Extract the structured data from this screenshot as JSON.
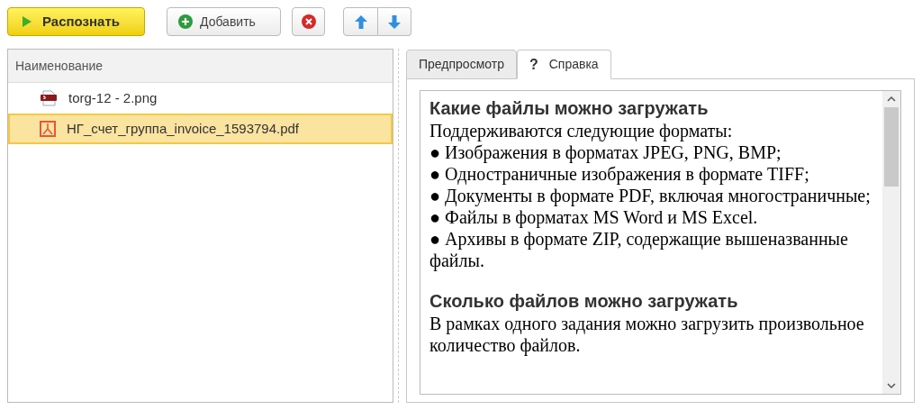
{
  "toolbar": {
    "recognize_button": "Распознать",
    "add_button": "Добавить"
  },
  "file_list": {
    "column": "Наименование",
    "rows": [
      {
        "name": "torg-12 - 2.png",
        "kind": "png",
        "selected": false
      },
      {
        "name": "НГ_счет_группа_invoice_1593794.pdf",
        "kind": "pdf",
        "selected": true
      }
    ]
  },
  "tabs": [
    {
      "label": "Предпросмотр",
      "selected": false
    },
    {
      "label": "Справка",
      "icon": "?",
      "selected": true
    }
  ],
  "help": [
    {
      "heading": "Какие файлы можно загружать",
      "intro": "Поддерживаются следующие форматы:",
      "bullets": [
        "● Изображения в форматах JPEG, PNG, BMP;",
        "● Одностраничные изображения в формате TIFF;",
        "● Документы в формате PDF, включая многостраничные;",
        "● Файлы в форматах MS Word и MS Excel.",
        "● Архивы в формате ZIP, содержащие вышеназванные файлы."
      ]
    },
    {
      "heading": "Сколько файлов можно загружать",
      "intro": "В рамках одного задания можно загрузить произвольное количество файлов."
    }
  ]
}
